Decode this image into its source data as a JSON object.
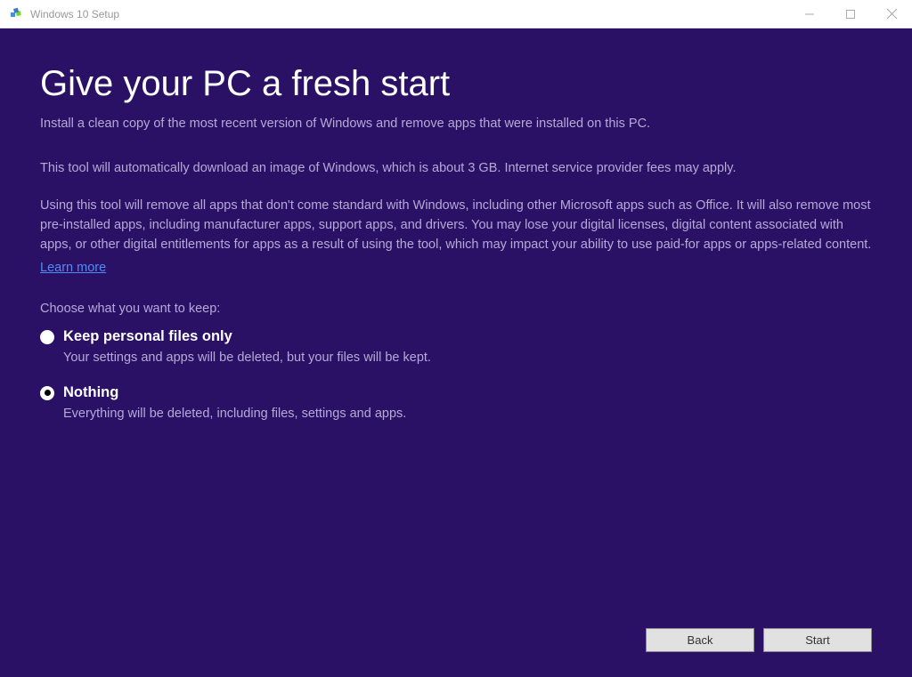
{
  "titlebar": {
    "title": "Windows 10 Setup"
  },
  "page": {
    "heading": "Give your PC a fresh start",
    "subtitle": "Install a clean copy of the most recent version of Windows and remove apps that were installed on this PC.",
    "info1": "This tool will automatically download an image of Windows, which is about 3 GB.  Internet service provider fees may apply.",
    "info2": "Using this tool will remove all apps that don't come standard with Windows, including other Microsoft apps such as Office. It will also remove most pre-installed apps, including manufacturer apps, support apps, and drivers. You may lose your digital licenses, digital content associated with apps, or other digital entitlements for apps as a result of using the tool, which may impact your ability to use paid-for apps or apps-related content.",
    "learn_more": "Learn more",
    "choose_label": "Choose what you want to keep:",
    "options": [
      {
        "label": "Keep personal files only",
        "desc": "Your settings and apps will be deleted, but your files will be kept.",
        "selected": false
      },
      {
        "label": "Nothing",
        "desc": "Everything will be deleted, including files, settings and apps.",
        "selected": true
      }
    ]
  },
  "buttons": {
    "back": "Back",
    "start": "Start"
  }
}
